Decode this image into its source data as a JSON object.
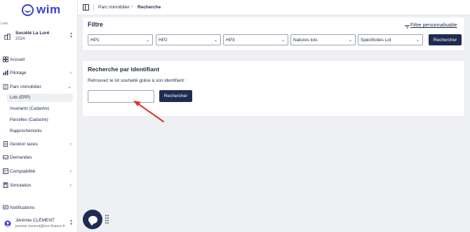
{
  "brand": {
    "logo_text": "wim"
  },
  "org": {
    "caption": "Loré",
    "name": "Société La Loré",
    "year": "2024"
  },
  "nav": {
    "accueil": "Accueil",
    "pilotage": "Pilotage",
    "parc": "Parc immobilier",
    "parc_sub": [
      "Lots (ERP)",
      "Invariants (Cadastre)",
      "Parcelles (Cadastre)",
      "Rapprochements"
    ],
    "gestion_taxes": "Gestion taxes",
    "demandes": "Demandes",
    "comptabilite": "Comptabilité",
    "simulation": "Simulation",
    "notifications": "Notifications"
  },
  "user": {
    "name": "Jérémie CLÉMENT",
    "email": "jeremie.clement@lore-finance.fr"
  },
  "breadcrumb": {
    "parent": "Parc immobilier",
    "current": "Recherche"
  },
  "filter": {
    "title": "Filtre",
    "custom_link": "Filtre personnalisable",
    "selects": [
      "HP1",
      "HP2",
      "HP3",
      "Natures lots",
      "Spécificités Lot"
    ],
    "search_button": "Rechercher"
  },
  "id_search": {
    "title": "Recherche par identifiant",
    "description": "Retrouvez le lot souhaité grâce à son identifiant :",
    "input_value": "",
    "search_button": "Rechercher"
  },
  "colors": {
    "primary": "#1e2b52",
    "brand": "#3b3fd0",
    "annotation": "#e0332c"
  }
}
